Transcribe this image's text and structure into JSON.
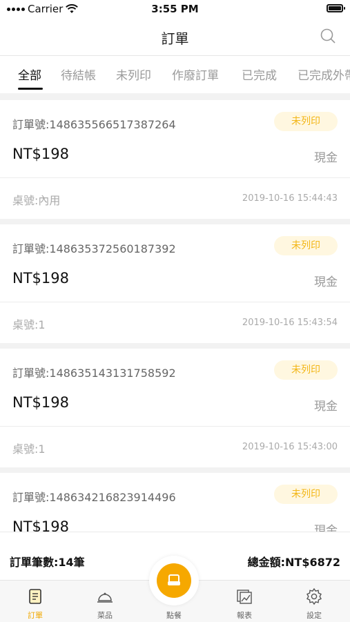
{
  "status_bar": {
    "carrier": "Carrier",
    "time": "3:55 PM"
  },
  "nav": {
    "title": "訂單"
  },
  "tabs": [
    "全部",
    "待結帳",
    "未列印",
    "作廢訂單",
    "已完成",
    "已完成外帶"
  ],
  "orders": [
    {
      "order_no": "訂單號:148635566517387264",
      "status": "未列印",
      "amount": "NT$198",
      "payment": "現金",
      "table": "桌號:內用",
      "time": "2019-10-16 15:44:43"
    },
    {
      "order_no": "訂單號:148635372560187392",
      "status": "未列印",
      "amount": "NT$198",
      "payment": "現金",
      "table": "桌號:1",
      "time": "2019-10-16 15:43:54"
    },
    {
      "order_no": "訂單號:148635143131758592",
      "status": "未列印",
      "amount": "NT$198",
      "payment": "現金",
      "table": "桌號:1",
      "time": "2019-10-16 15:43:00"
    },
    {
      "order_no": "訂單號:148634216823914496",
      "status": "未列印",
      "amount": "NT$198",
      "payment": "現金",
      "table": "",
      "time": ""
    }
  ],
  "summary": {
    "count": "訂單筆數:14筆",
    "total": "總金額:NT$6872"
  },
  "tabbar": {
    "orders": "訂單",
    "menu": "菜品",
    "order_food": "點餐",
    "reports": "報表",
    "settings": "設定"
  },
  "colors": {
    "accent": "#f6a800",
    "badge_bg": "#fff7e0"
  }
}
